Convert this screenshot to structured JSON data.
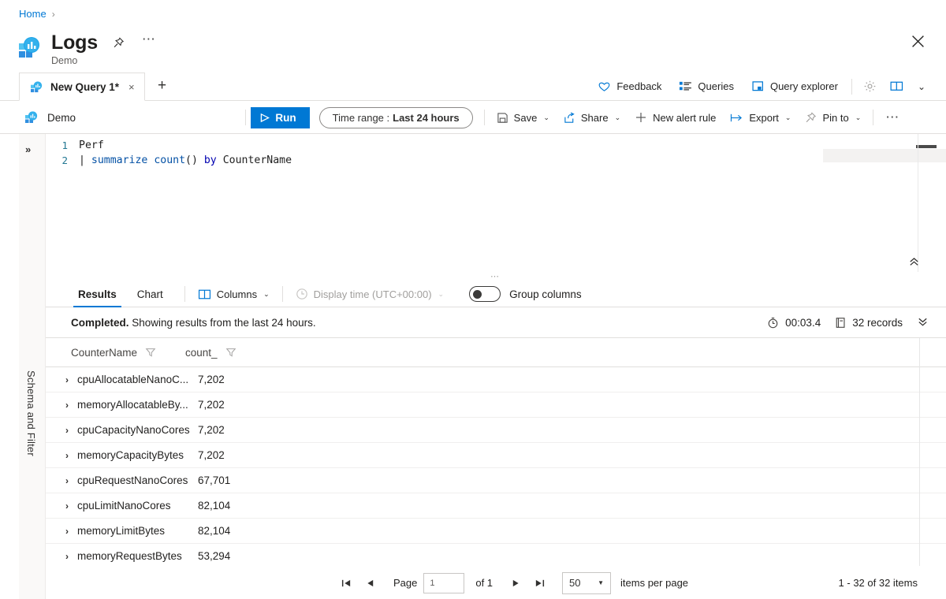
{
  "breadcrumb": {
    "home": "Home"
  },
  "header": {
    "title": "Logs",
    "subtitle": "Demo",
    "pin_icon": "pin-icon",
    "more_icon": "ellipsis-icon",
    "close_icon": "close-icon",
    "logs_icon": "logs-icon"
  },
  "tabs": {
    "items": [
      {
        "label": "New Query 1*",
        "icon": "query-icon",
        "close": "×"
      }
    ],
    "add_label": "+"
  },
  "top_actions": [
    {
      "label": "Feedback",
      "icon": "heart-icon"
    },
    {
      "label": "Queries",
      "icon": "list-icon"
    },
    {
      "label": "Query explorer",
      "icon": "explorer-icon"
    }
  ],
  "top_icon_actions": [
    {
      "label": "",
      "icon": "gear-icon"
    },
    {
      "label": "",
      "icon": "book-icon"
    },
    {
      "label": "",
      "icon": "chevron-down-icon"
    }
  ],
  "command_bar": {
    "workspace": "Demo",
    "workspace_icon": "workspace-icon",
    "run_label": "Run",
    "run_icon": "play-icon",
    "time_range_prefix": "Time range :",
    "time_range_value": "Last 24 hours",
    "buttons": [
      {
        "label": "Save",
        "icon": "save-icon",
        "caret": "⌄"
      },
      {
        "label": "Share",
        "icon": "share-icon",
        "caret": "⌄"
      },
      {
        "label": "New alert rule",
        "icon": "plus-icon",
        "caret": ""
      },
      {
        "label": "Export",
        "icon": "export-icon",
        "caret": "⌄"
      },
      {
        "label": "Pin to",
        "icon": "pin-icon",
        "caret": "⌄"
      }
    ],
    "overflow_icon": "ellipsis-icon"
  },
  "left_rail": {
    "expand_icon": "double-chevron-right-icon",
    "vertical_label": "Schema and Filter"
  },
  "editor": {
    "lines": [
      {
        "number": "1",
        "tokens": [
          {
            "t": "Perf",
            "c": "tok-plain"
          }
        ]
      },
      {
        "number": "2",
        "tokens": [
          {
            "t": "| ",
            "c": "tok-op"
          },
          {
            "t": "summarize",
            "c": "tok-kw"
          },
          {
            "t": " ",
            "c": "tok-plain"
          },
          {
            "t": "count",
            "c": "tok-fn"
          },
          {
            "t": "()",
            "c": "tok-op"
          },
          {
            "t": " ",
            "c": "tok-plain"
          },
          {
            "t": "by",
            "c": "tok-by"
          },
          {
            "t": " CounterName",
            "c": "tok-plain"
          }
        ]
      }
    ],
    "collapse_icon": "double-chevron-up-icon"
  },
  "results": {
    "tabs": [
      {
        "label": "Results",
        "active": true
      },
      {
        "label": "Chart",
        "active": false
      }
    ],
    "columns_label": "Columns",
    "columns_icon": "columns-icon",
    "display_time_label": "Display time (UTC+00:00)",
    "display_time_icon": "clock-icon",
    "group_columns_label": "Group columns",
    "group_columns_on": false
  },
  "status": {
    "bold": "Completed.",
    "text": " Showing results from the last 24 hours.",
    "duration": "00:03.4",
    "duration_icon": "timer-icon",
    "records": "32 records",
    "records_icon": "records-icon",
    "collapse_icon": "double-chevron-down-icon"
  },
  "table": {
    "headers": [
      "CounterName",
      "count_"
    ],
    "filter_icon": "filter-funnel-icon",
    "expander_icon": "chevron-right-icon",
    "rows": [
      {
        "name": "cpuAllocatableNanoC...",
        "count": "7,202"
      },
      {
        "name": "memoryAllocatableBy...",
        "count": "7,202"
      },
      {
        "name": "cpuCapacityNanoCores",
        "count": "7,202"
      },
      {
        "name": "memoryCapacityBytes",
        "count": "7,202"
      },
      {
        "name": "cpuRequestNanoCores",
        "count": "67,701"
      },
      {
        "name": "cpuLimitNanoCores",
        "count": "82,104"
      },
      {
        "name": "memoryLimitBytes",
        "count": "82,104"
      },
      {
        "name": "memoryRequestBytes",
        "count": "53,294"
      }
    ]
  },
  "pager": {
    "first_icon": "◀|",
    "prev_icon": "◀",
    "page_label": "Page",
    "page_value": "1",
    "of_label": "of 1",
    "next_icon": "▶",
    "last_icon": "|▶",
    "page_size": "50",
    "items_per_page_label": "items per page",
    "range_label": "1 - 32 of 32 items"
  }
}
